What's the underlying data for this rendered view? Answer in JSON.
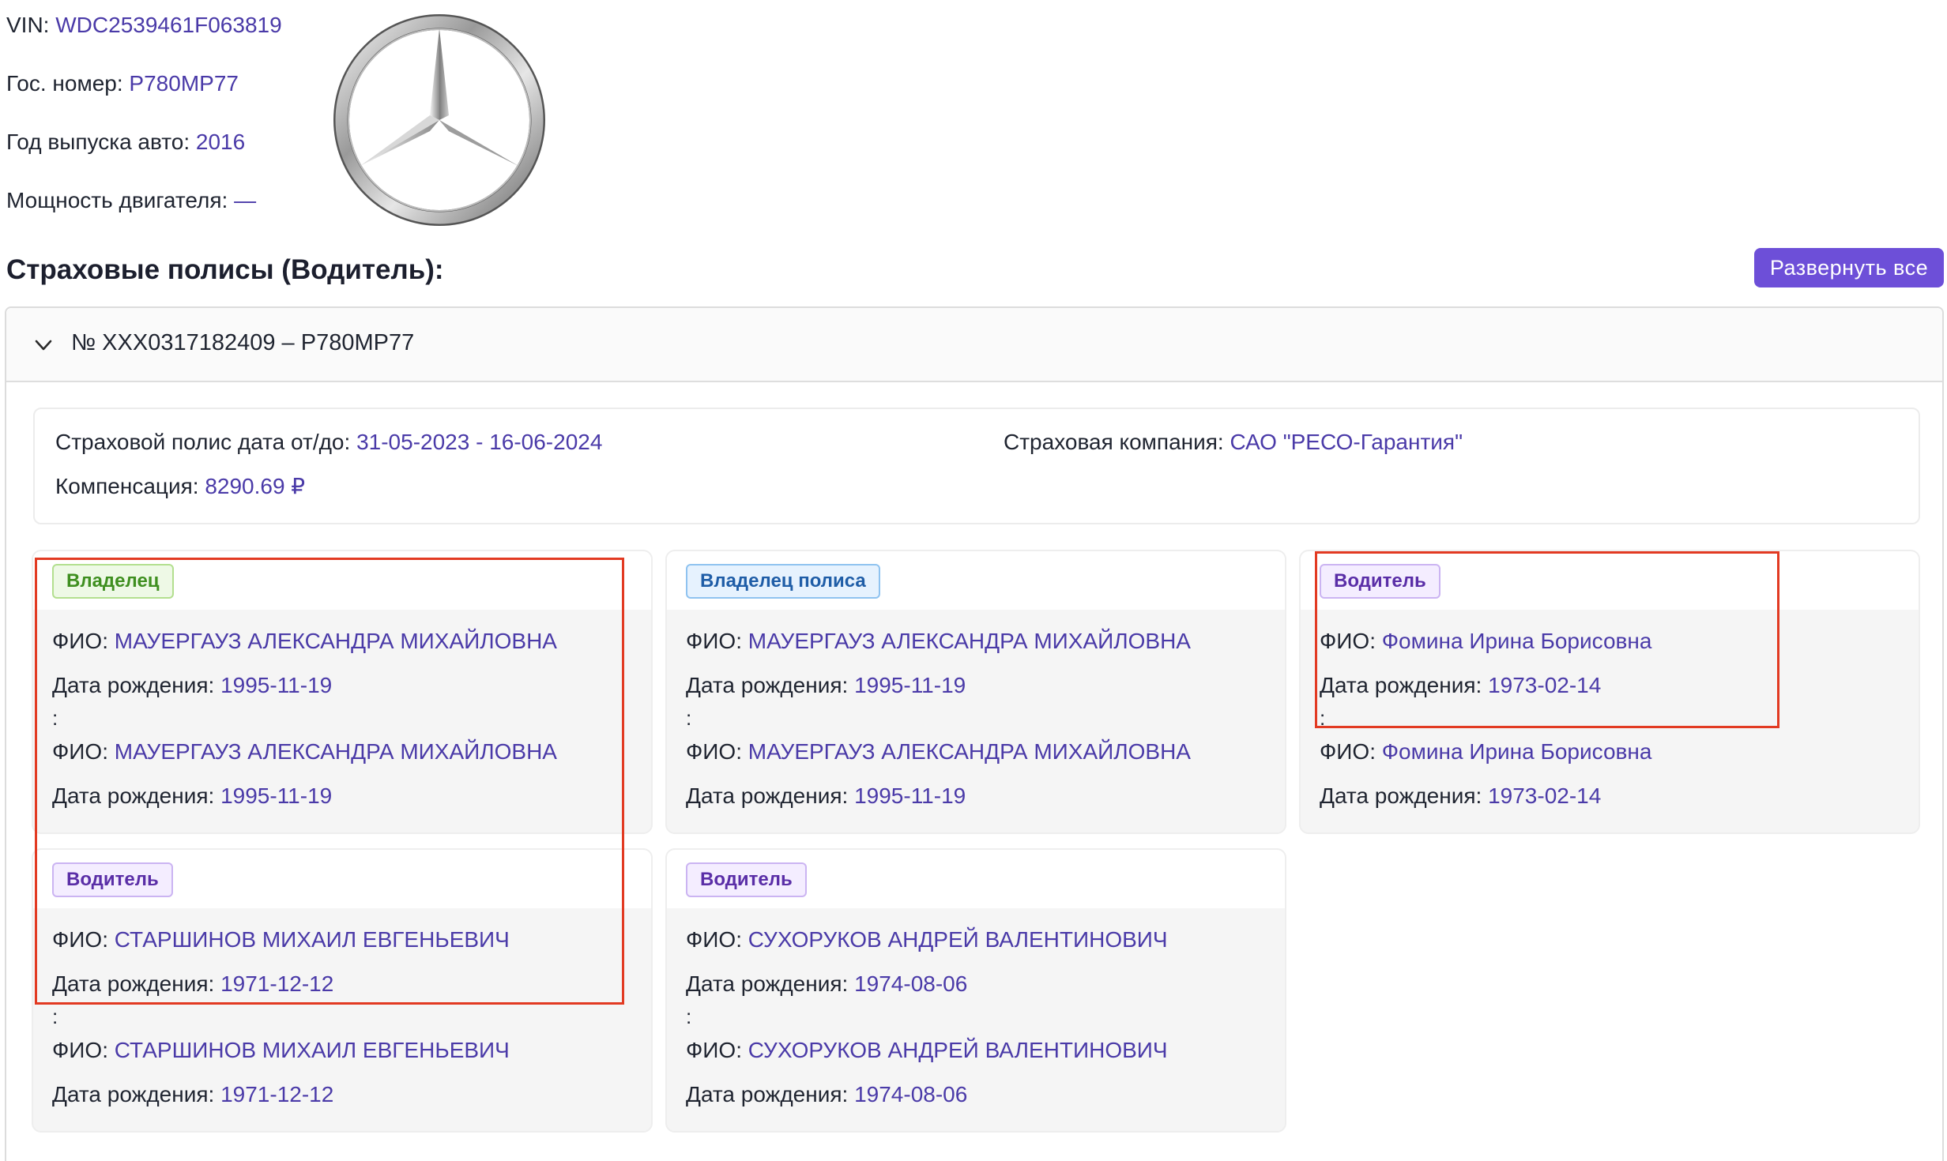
{
  "car": {
    "vin_label": "VIN:",
    "vin_value": "WDC2539461F063819",
    "plate_label": "Гос. номер:",
    "plate_value": "Р780МР77",
    "year_label": "Год выпуска авто:",
    "year_value": "2016",
    "power_label": "Мощность двигателя:",
    "power_value": "—",
    "logo_icon": "mercedes-star-logo"
  },
  "section": {
    "title": "Страховые полисы (Водитель):",
    "expand_label": "Развернуть все"
  },
  "policy": {
    "header": "№ ХХХ0317182409 – Р780МР77",
    "dates_label": "Страховой полис дата от/до:",
    "dates_value": "31-05-2023 - 16-06-2024",
    "company_label": "Страховая компания:",
    "company_value": "САО \"РЕСО-Гарантия\"",
    "compensation_label": "Компенсация:",
    "compensation_value": "8290.69 ₽"
  },
  "labels": {
    "fio": "ФИО:",
    "birth": "Дата рождения:",
    "sep": ":"
  },
  "cards": [
    {
      "role": "Владелец",
      "fio1": "МАУЕРГАУЗ АЛЕКСАНДРА МИХАЙЛОВНА",
      "birth1": "1995-11-19",
      "fio2": "МАУЕРГАУЗ АЛЕКСАНДРА МИХАЙЛОВНА",
      "birth2": "1995-11-19"
    },
    {
      "role": "Владелец полиса",
      "fio1": "МАУЕРГАУЗ АЛЕКСАНДРА МИХАЙЛОВНА",
      "birth1": "1995-11-19",
      "fio2": "МАУЕРГАУЗ АЛЕКСАНДРА МИХАЙЛОВНА",
      "birth2": "1995-11-19"
    },
    {
      "role": "Водитель",
      "fio1": "Фомина Ирина Борисовна",
      "birth1": "1973-02-14",
      "fio2": "Фомина Ирина Борисовна",
      "birth2": "1973-02-14"
    },
    {
      "role": "Водитель",
      "fio1": "СТАРШИНОВ МИХАИЛ ЕВГЕНЬЕВИЧ",
      "birth1": "1971-12-12",
      "fio2": "СТАРШИНОВ МИХАИЛ ЕВГЕНЬЕВИЧ",
      "birth2": "1971-12-12"
    },
    {
      "role": "Водитель",
      "fio1": "СУХОРУКОВ АНДРЕЙ ВАЛЕНТИНОВИЧ",
      "birth1": "1974-08-06",
      "fio2": "СУХОРУКОВ АНДРЕЙ ВАЛЕНТИНОВИЧ",
      "birth2": "1974-08-06"
    }
  ],
  "colors": {
    "accent": "#6d4fd8",
    "value_text": "#4a3aa8",
    "annotation": "#e23a22"
  }
}
